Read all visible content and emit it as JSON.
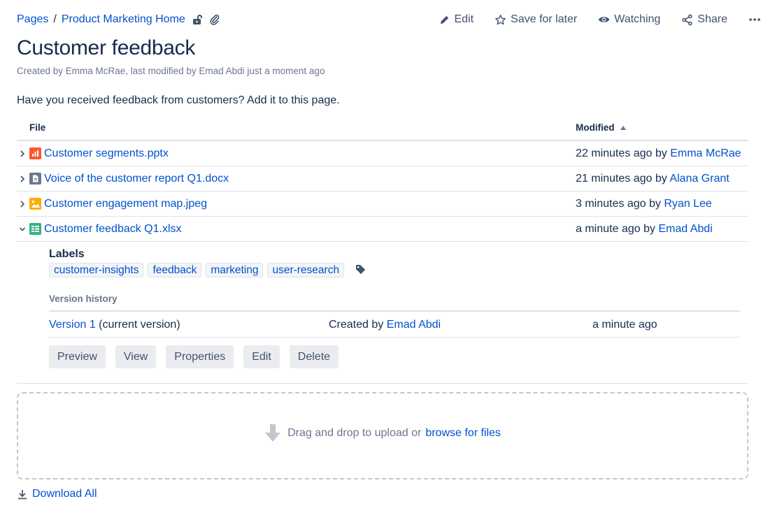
{
  "breadcrumb": {
    "root": "Pages",
    "separator": "/",
    "parent": "Product Marketing Home"
  },
  "actions": {
    "edit": "Edit",
    "save": "Save for later",
    "watching": "Watching",
    "share": "Share"
  },
  "page": {
    "title": "Customer feedback",
    "byline": "Created by Emma McRae, last modified by Emad Abdi just a moment ago",
    "intro": "Have you received feedback from customers? Add it to this page."
  },
  "table": {
    "col_file": "File",
    "col_modified": "Modified",
    "rows": [
      {
        "name": "Customer segments.pptx",
        "time": "22 minutes ago by",
        "user": "Emma McRae",
        "icon": "presentation-icon",
        "icon_color": "#ff5630"
      },
      {
        "name": "Voice of the customer report Q1.docx",
        "time": "21 minutes ago by",
        "user": "Alana Grant",
        "icon": "document-icon",
        "icon_color": "#6b778c"
      },
      {
        "name": "Customer engagement map.jpeg",
        "time": "3 minutes ago by",
        "user": "Ryan Lee",
        "icon": "image-icon",
        "icon_color": "#ffab00"
      },
      {
        "name": "Customer feedback Q1.xlsx",
        "time": "a minute ago by",
        "user": "Emad Abdi",
        "icon": "spreadsheet-icon",
        "icon_color": "#36b37e"
      }
    ]
  },
  "details": {
    "labels_title": "Labels",
    "labels": [
      "customer-insights",
      "feedback",
      "marketing",
      "user-research"
    ],
    "version_history_title": "Version history",
    "version": {
      "link": "Version 1",
      "suffix": "(current version)",
      "created_prefix": "Created by",
      "created_by": "Emad Abdi",
      "time": "a minute ago"
    },
    "buttons": [
      "Preview",
      "View",
      "Properties",
      "Edit",
      "Delete"
    ]
  },
  "upload": {
    "text": "Drag and drop to upload or",
    "link": "browse for files"
  },
  "download_all": "Download All",
  "colors": {
    "link": "#0052cc",
    "text": "#172b4d",
    "muted": "#6b778c"
  }
}
